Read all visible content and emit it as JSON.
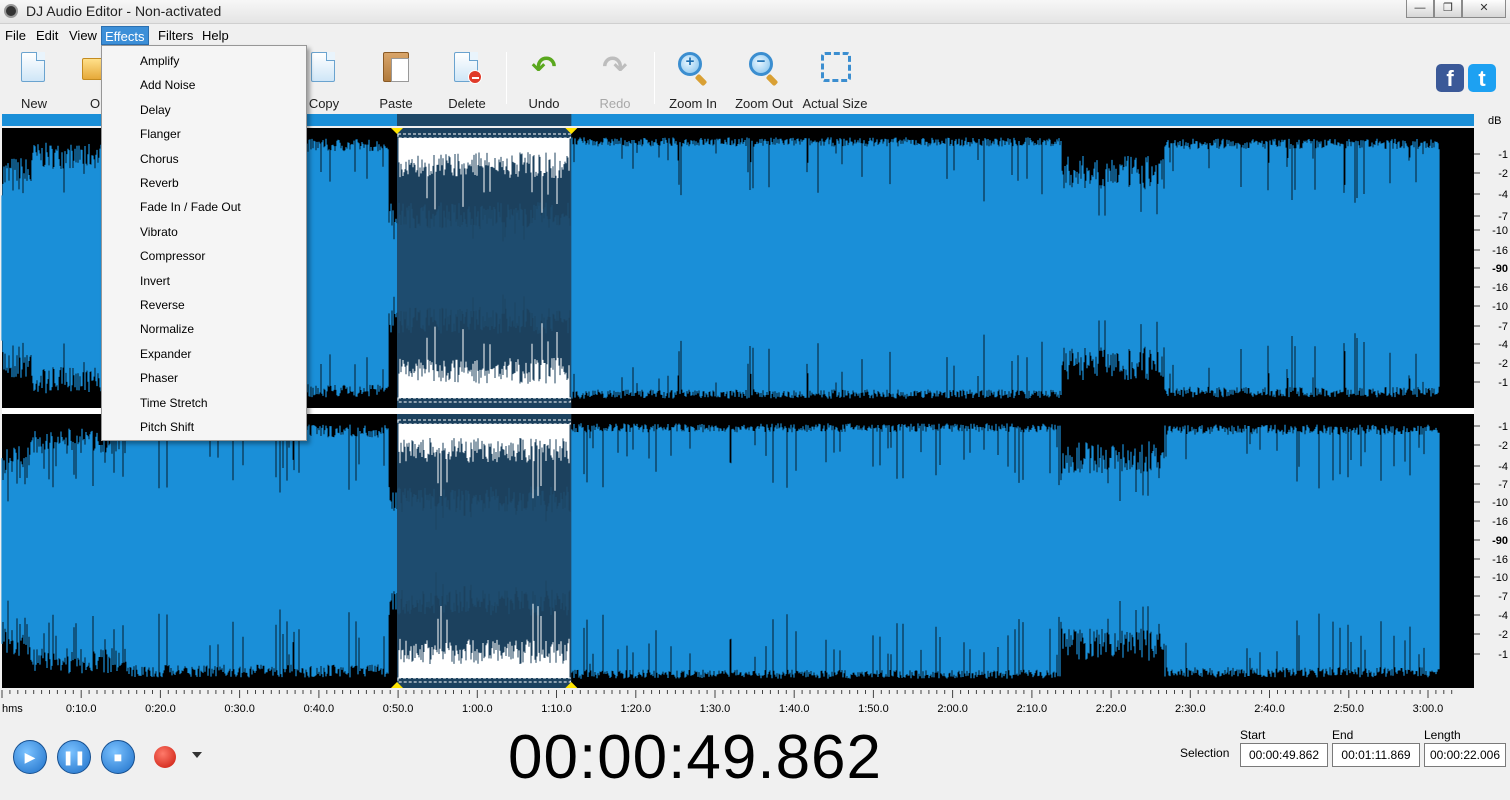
{
  "window": {
    "title": "DJ Audio Editor - Non-activated",
    "controls": [
      "—",
      "❐",
      "✕"
    ]
  },
  "menu": {
    "items": [
      {
        "label": "File"
      },
      {
        "label": "Edit"
      },
      {
        "label": "View"
      },
      {
        "label": "Effects",
        "active": true
      },
      {
        "label": "Filters"
      },
      {
        "label": "Help"
      }
    ]
  },
  "toolbar": {
    "new": "New",
    "open": "O",
    "copy": "Copy",
    "paste": "Paste",
    "delete": "Delete",
    "undo": "Undo",
    "redo": "Redo",
    "zoom_in": "Zoom In",
    "zoom_out": "Zoom Out",
    "actual_size": "Actual Size",
    "facebook": "f",
    "twitter": "t"
  },
  "effects_menu": {
    "items": [
      "Amplify",
      "Add Noise",
      "Delay",
      "Flanger",
      "Chorus",
      "Reverb",
      "Fade In / Fade Out",
      "Vibrato",
      "Compressor",
      "Invert",
      "Reverse",
      "Normalize",
      "Expander",
      "Phaser",
      "Time Stretch",
      "Pitch Shift"
    ]
  },
  "waveform": {
    "db_unit": "dB",
    "db_labels": [
      "-1",
      "-2",
      "-4",
      "-7",
      "-10",
      "-16",
      "-90",
      "-16",
      "-10",
      "-7",
      "-4",
      "-2",
      "-1"
    ],
    "time_unit": "hms",
    "time_labels": [
      "0:10.0",
      "0:20.0",
      "0:30.0",
      "0:40.0",
      "0:50.0",
      "1:00.0",
      "1:10.0",
      "1:20.0",
      "1:30.0",
      "1:40.0",
      "1:50.0",
      "2:00.0",
      "2:10.0",
      "2:20.0",
      "2:30.0",
      "2:40.0",
      "2:50.0",
      "3:00.0"
    ],
    "selection_start_seconds": 49.862,
    "selection_end_seconds": 71.869,
    "total_seconds": 183,
    "colors": {
      "wave": "#1a8fd8",
      "background": "#000000",
      "selection": "#1e4766",
      "selected_wave": "#ffffff",
      "timeline_bar": "#1a8fd8"
    }
  },
  "transport": {
    "current_time": "00:00:49.862",
    "selection_label": "Selection",
    "start_label": "Start",
    "end_label": "End",
    "length_label": "Length",
    "start_value": "00:00:49.862",
    "end_value": "00:01:11.869",
    "length_value": "00:00:22.006"
  }
}
